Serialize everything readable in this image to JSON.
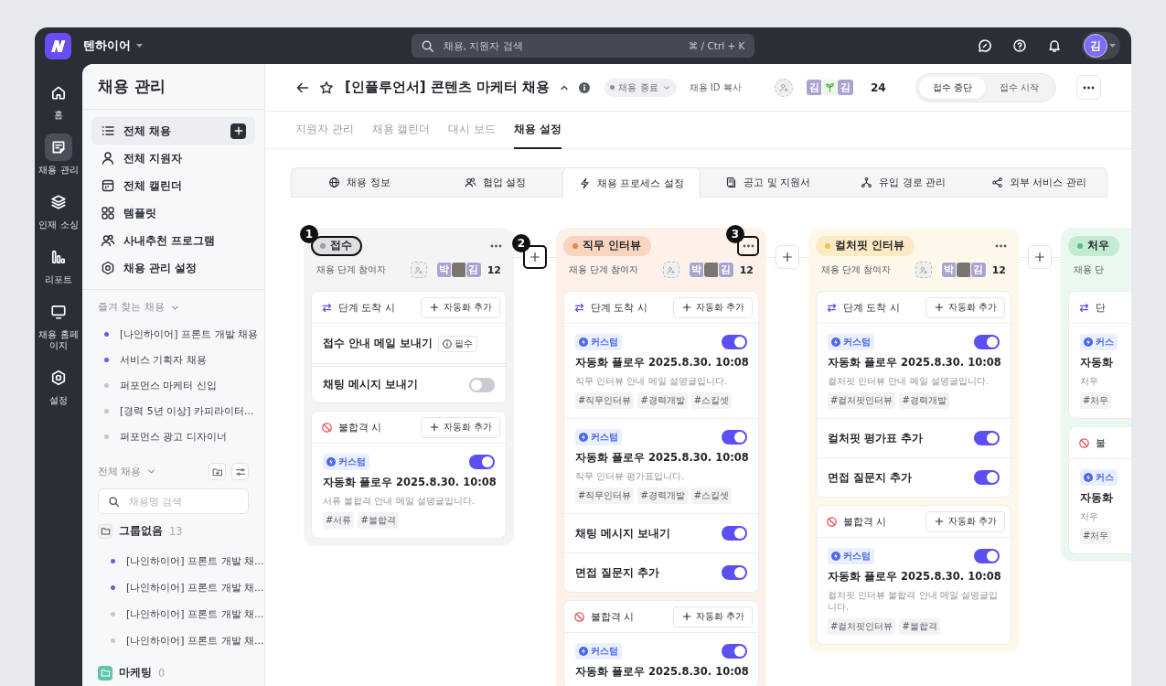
{
  "top_bar": {
    "workspace": "텐하이어",
    "search": {
      "placeholder": "채용, 지원자 검색",
      "shortcut": "⌘ / Ctrl + K"
    },
    "avatar": "김"
  },
  "rail": {
    "items": [
      {
        "label": "홈",
        "selected": false
      },
      {
        "label": "채용 관리",
        "selected": true
      },
      {
        "label": "인재 소싱",
        "selected": false
      },
      {
        "label": "리포트",
        "selected": false
      },
      {
        "label": "채용 홈페이지",
        "selected": false
      },
      {
        "label": "설정",
        "selected": false
      }
    ]
  },
  "sidebar": {
    "title": "채용 관리",
    "nav": [
      {
        "label": "전체 채용",
        "selected": true
      },
      {
        "label": "전체 지원자",
        "selected": false
      },
      {
        "label": "전체 캘린더",
        "selected": false
      },
      {
        "label": "템플릿",
        "selected": false
      },
      {
        "label": "사내추천 프로그램",
        "selected": false
      },
      {
        "label": "채용 관리 설정",
        "selected": false
      }
    ],
    "favorites": {
      "title": "즐겨 찾는 채용",
      "items": [
        {
          "label": "[나인하이어] 프론트 개발 채용",
          "color": "#6a5af0"
        },
        {
          "label": "서비스 기획자 채용",
          "color": "#6a5af0"
        },
        {
          "label": "퍼포먼스 마케터 신입",
          "color": "#c3c6cd"
        },
        {
          "label": "[경력 5년 이상] 카피라이터...",
          "color": "#c3c6cd"
        },
        {
          "label": "퍼포먼스 광고 디자이너",
          "color": "#c3c6cd"
        }
      ]
    },
    "all": {
      "title": "전체 채용",
      "search": {
        "placeholder": "채용명 검색"
      },
      "groups": [
        {
          "name": "그룹없음",
          "count": "13",
          "color": "#f1f2f4",
          "items": [
            {
              "label": "[나인하이어] 프론트 개발 채...",
              "color": "#6a5af0"
            },
            {
              "label": "[나인하이어] 프론트 개발 채...",
              "color": "#6a5af0"
            },
            {
              "label": "[나인하이어] 프론트 개발 채...",
              "color": "#c3c6cd"
            },
            {
              "label": "[나인하이어] 프론트 개발 채...",
              "color": "#c3c6cd"
            }
          ]
        },
        {
          "name": "마케팅",
          "count": "0",
          "color": "#5fc4aa"
        }
      ]
    }
  },
  "header": {
    "title": "[인플루언서] 콘텐츠 마케터 채용",
    "status": "채용 종료",
    "copy_link": "채용 ID 복사",
    "members": [
      {
        "kind": "initial",
        "initial": "김"
      },
      {
        "kind": "sprout"
      },
      {
        "kind": "initial",
        "initial": "김"
      }
    ],
    "member_count": "24",
    "actions": [
      {
        "label": "접수 중단",
        "selected": true
      },
      {
        "label": "접수 시작",
        "selected": false
      }
    ]
  },
  "page_tabs": [
    {
      "label": "지원자 관리",
      "selected": false
    },
    {
      "label": "채용 캘린더",
      "selected": false
    },
    {
      "label": "대시 보드",
      "selected": false
    },
    {
      "label": "채용 설정",
      "selected": true
    }
  ],
  "settings_tabs": [
    {
      "label": "채용 정보",
      "selected": false
    },
    {
      "label": "협업 설정",
      "selected": false
    },
    {
      "label": "채용 프로세스 설정",
      "selected": true
    },
    {
      "label": "공고 및 지원서",
      "selected": false
    },
    {
      "label": "유입 경로 관리",
      "selected": false
    },
    {
      "label": "외부 서비스 관리",
      "selected": false
    }
  ],
  "stages": [
    {
      "label": "접수",
      "color": "#9a9ea6",
      "label_marker": "1",
      "add_marker": "2",
      "participants": {
        "label": "채용 단계 참여자",
        "members": [
          {
            "kind": "initial",
            "initial": "박"
          },
          {
            "kind": "photo"
          },
          {
            "kind": "initial",
            "initial": "김"
          }
        ],
        "count": "12"
      },
      "sections": [
        {
          "kind": "arrival",
          "title": "단계 도착 시",
          "button": "자동화 추가",
          "items": [
            {
              "kind": "required",
              "title": "접수 안내 메일 보내기",
              "badge": "필수"
            },
            {
              "kind": "toggle",
              "title": "채팅 메시지 보내기",
              "on": false
            }
          ]
        },
        {
          "kind": "reject",
          "title": "불합격 시",
          "button": "자동화 추가",
          "items": [
            {
              "kind": "flow",
              "tag": "커스텀",
              "title": "자동화 플로우 2025.8.30. 10:08",
              "desc": "서류 불합격 안내 메일 설명글입니다.",
              "hashtags": [
                "#서류",
                "#불합격"
              ],
              "on": true
            }
          ]
        }
      ]
    },
    {
      "label": "직무 인터뷰",
      "color": "#f08443",
      "more_marker": "3",
      "participants": {
        "label": "채용 단계 참여자",
        "members": [
          {
            "kind": "initial",
            "initial": "박"
          },
          {
            "kind": "photo"
          },
          {
            "kind": "initial",
            "initial": "김"
          }
        ],
        "count": "12"
      },
      "sections": [
        {
          "kind": "arrival",
          "title": "단계 도착 시",
          "button": "자동화 추가",
          "items": [
            {
              "kind": "flow",
              "tag": "커스텀",
              "title": "자동화 플로우 2025.8.30. 10:08",
              "desc": "직무 인터뷰 안내 메일 설명글입니다.",
              "hashtags": [
                "#직무인터뷰",
                "#경력개발",
                "#스킬셋"
              ],
              "on": true
            },
            {
              "kind": "flow",
              "tag": "커스텀",
              "title": "자동화 플로우 2025.8.30. 10:08",
              "desc": "직무 인터뷰 평가표입니다.",
              "hashtags": [
                "#직무인터뷰",
                "#경력개발",
                "#스킬셋"
              ],
              "on": true
            },
            {
              "kind": "toggle",
              "title": "채팅 메시지 보내기",
              "on": true
            },
            {
              "kind": "toggle",
              "title": "면접 질문지 추가",
              "on": true
            }
          ]
        },
        {
          "kind": "reject",
          "title": "불합격 시",
          "button": "자동화 추가",
          "items": [
            {
              "kind": "flow",
              "tag": "커스텀",
              "title": "자동화 플로우 2025.8.30. 10:08",
              "on": true
            }
          ]
        }
      ]
    },
    {
      "label": "컬처핏 인터뷰",
      "color": "#f4c04a",
      "participants": {
        "label": "채용 단계 참여자",
        "members": [
          {
            "kind": "initial",
            "initial": "박"
          },
          {
            "kind": "photo"
          },
          {
            "kind": "initial",
            "initial": "김"
          }
        ],
        "count": "12"
      },
      "sections": [
        {
          "kind": "arrival",
          "title": "단계 도착 시",
          "button": "자동화 추가",
          "items": [
            {
              "kind": "flow",
              "tag": "커스텀",
              "title": "자동화 플로우 2025.8.30. 10:08",
              "desc": "컬처핏 인터뷰 안내 메일 설명글입니다.",
              "hashtags": [
                "#컬처핏인터뷰",
                "#경력개발"
              ],
              "on": true
            },
            {
              "kind": "toggle",
              "title": "컬처핏 평가표 추가",
              "on": true
            },
            {
              "kind": "toggle",
              "title": "면접 질문지 추가",
              "on": true
            }
          ]
        },
        {
          "kind": "reject",
          "title": "불합격 시",
          "button": "자동화 추가",
          "items": [
            {
              "kind": "flow",
              "tag": "커스텀",
              "title": "자동화 플로우 2025.8.30. 10:08",
              "desc": "컬처핏 인터뷰 불합격 안내 메일 설명글입니다.",
              "hashtags": [
                "#컬처핏인터뷰",
                "#불합격"
              ],
              "on": true
            }
          ]
        }
      ]
    },
    {
      "label": "처우",
      "color": "#4cc27a",
      "participants": {
        "label": "채용 단"
      },
      "sections": [
        {
          "kind": "arrival",
          "title": "단",
          "items": [
            {
              "kind": "flow",
              "tag": "커스",
              "title": "자동화",
              "desc": "처우",
              "hashtags": [
                "#처우"
              ]
            }
          ]
        },
        {
          "kind": "reject",
          "title": "불",
          "items": [
            {
              "kind": "flow",
              "tag": "커스",
              "title": "자동화",
              "desc": "처우",
              "hashtags": [
                "#처우"
              ]
            }
          ]
        }
      ]
    }
  ]
}
